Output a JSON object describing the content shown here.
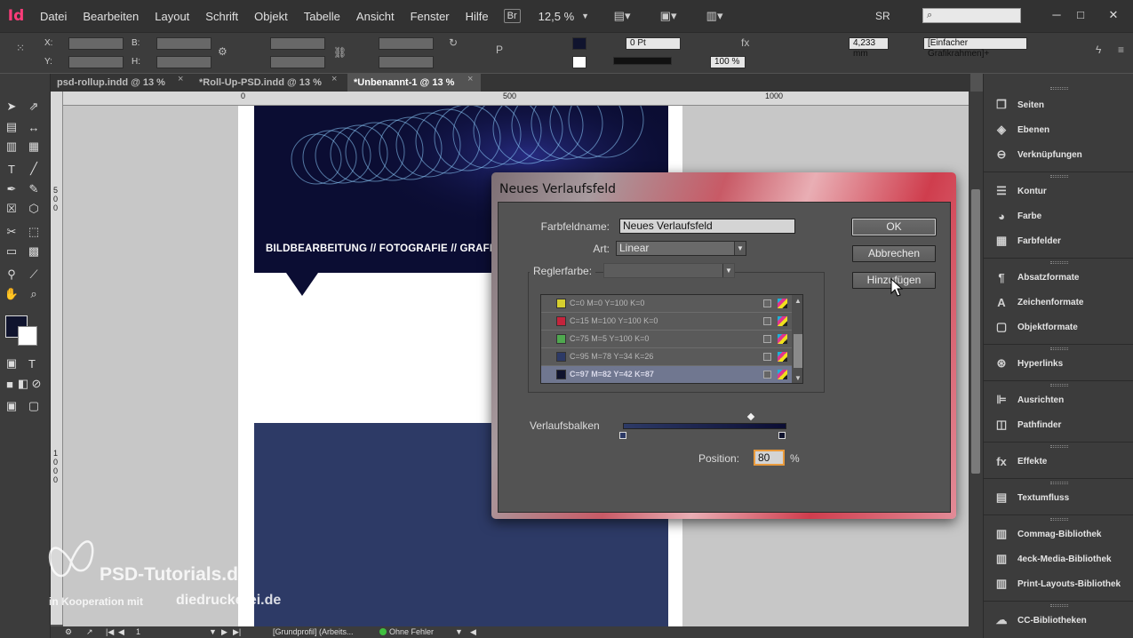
{
  "menubar": {
    "app_logo": "Id",
    "items": [
      "Datei",
      "Bearbeiten",
      "Layout",
      "Schrift",
      "Objekt",
      "Tabelle",
      "Ansicht",
      "Fenster",
      "Hilfe"
    ],
    "bridge": "Br",
    "zoom": "12,5 %",
    "workspace": "SR"
  },
  "controlbar": {
    "x_label": "X:",
    "y_label": "Y:",
    "w_label": "B:",
    "h_label": "H:",
    "stroke_weight": "0 Pt",
    "gap": "4,233 mm",
    "scale": "100 %",
    "object_style": "[Einfacher Grafikrahmen]+"
  },
  "tabs": [
    {
      "label": "psd-rollup.indd @ 13 %",
      "close": "×"
    },
    {
      "label": "*Roll-Up-PSD.indd @ 13 %",
      "close": "×"
    },
    {
      "label": "*Unbenannt-1 @ 13 %",
      "close": "×"
    }
  ],
  "rulers": {
    "h": [
      "0",
      "500",
      "1000"
    ],
    "v": [
      "5",
      "0",
      "0",
      "1",
      "0",
      "0",
      "0"
    ]
  },
  "canvas": {
    "hero_text": "BILDBEARBEITUNG // FOTOGRAFIE // GRAFI",
    "watermark_brand": "PSD-Tutorials.de",
    "watermark_coop": "in Kooperation mit",
    "watermark_partner": "diedrucker̲ei.de"
  },
  "statusbar": {
    "page": "1",
    "profile": "[Grundprofil] (Arbeits...",
    "errors": "Ohne Fehler"
  },
  "panels": [
    {
      "label": "Seiten",
      "icon": "pages-icon"
    },
    {
      "label": "Ebenen",
      "icon": "layers-icon"
    },
    {
      "label": "Verknüpfungen",
      "icon": "links-icon"
    },
    {
      "label": "Kontur",
      "icon": "stroke-icon"
    },
    {
      "label": "Farbe",
      "icon": "color-icon"
    },
    {
      "label": "Farbfelder",
      "icon": "swatches-icon"
    },
    {
      "label": "Absatzformate",
      "icon": "paragraph-styles-icon"
    },
    {
      "label": "Zeichenformate",
      "icon": "character-styles-icon"
    },
    {
      "label": "Objektformate",
      "icon": "object-styles-icon"
    },
    {
      "label": "Hyperlinks",
      "icon": "hyperlinks-icon"
    },
    {
      "label": "Ausrichten",
      "icon": "align-icon"
    },
    {
      "label": "Pathfinder",
      "icon": "pathfinder-icon"
    },
    {
      "label": "Effekte",
      "icon": "effects-icon"
    },
    {
      "label": "Textumfluss",
      "icon": "text-wrap-icon"
    },
    {
      "label": "Commag-Bibliothek",
      "icon": "library-icon"
    },
    {
      "label": "4eck-Media-Bibliothek",
      "icon": "library-icon"
    },
    {
      "label": "Print-Layouts-Bibliothek",
      "icon": "library-icon"
    },
    {
      "label": "CC-Bibliotheken",
      "icon": "cc-libraries-icon"
    }
  ],
  "dialog": {
    "title": "Neues Verlaufsfeld",
    "name_label": "Farbfeldname:",
    "name_value": "Neues Verlaufsfeld",
    "type_label": "Art:",
    "type_value": "Linear",
    "stop_color_label": "Reglerfarbe:",
    "swatches": [
      {
        "name": "C=0 M=0 Y=100 K=0",
        "color": "#d6cf2e"
      },
      {
        "name": "C=15 M=100 Y=100 K=0",
        "color": "#c4243c"
      },
      {
        "name": "C=75 M=5 Y=100 K=0",
        "color": "#4fa84f"
      },
      {
        "name": "C=95 M=78 Y=34 K=26",
        "color": "#2d3a66"
      },
      {
        "name": "C=97 M=82 Y=42 K=87",
        "color": "#10142e"
      }
    ],
    "gradient_label": "Verlaufsbalken",
    "position_label": "Position:",
    "position_value": "80",
    "position_unit": "%",
    "ok": "OK",
    "cancel": "Abbrechen",
    "add": "Hinzufügen"
  }
}
